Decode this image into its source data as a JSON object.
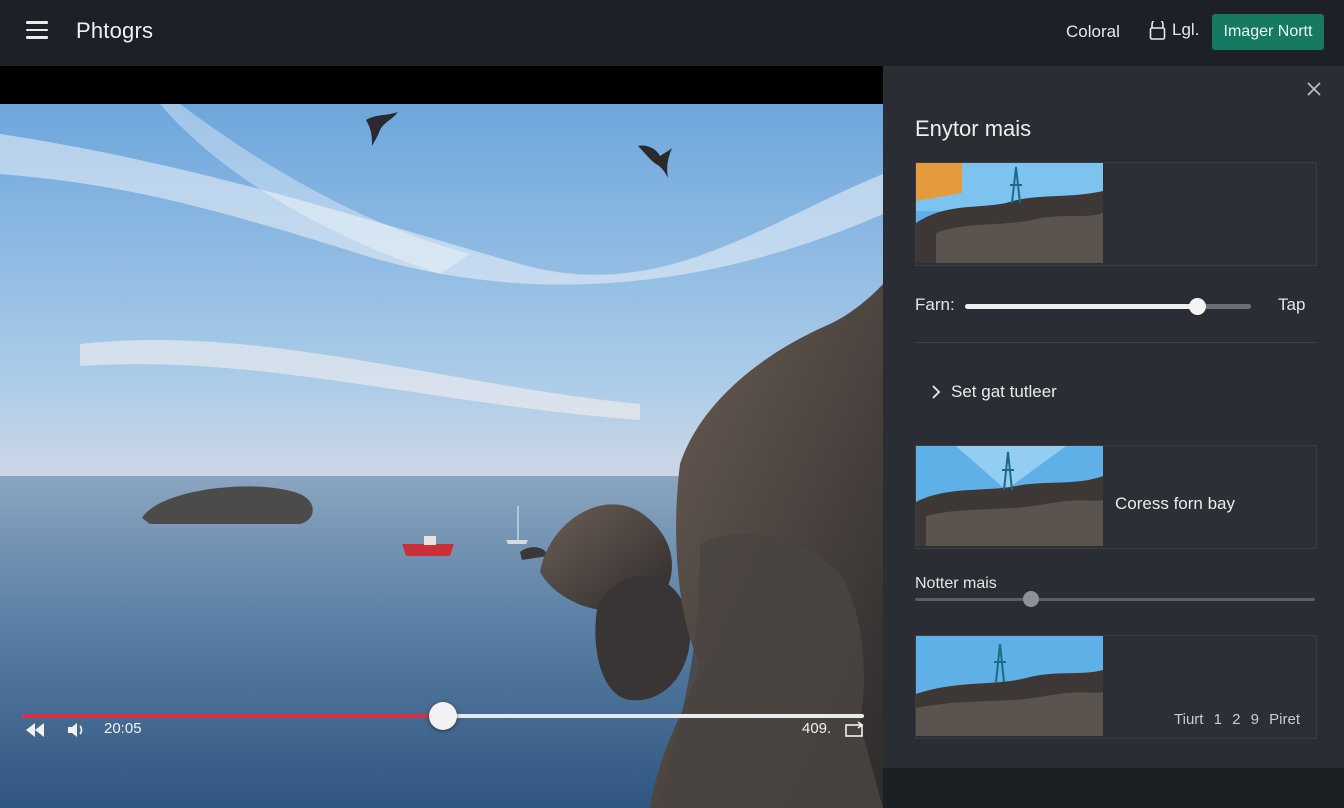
{
  "header": {
    "brand": "Phtogrs",
    "link": "Coloral",
    "login": "Lgl.",
    "cta": "Imager Nortt"
  },
  "player": {
    "current_time": "20:05",
    "duration": "409.",
    "progress": 0.5
  },
  "panel": {
    "title": "Enytor mais",
    "slider": {
      "label": "Farn:",
      "right_label": "Tap",
      "value": 0.81
    },
    "expander_label": "Set gat tutleer",
    "card2_label": "Coress forn bay",
    "thin_slider": {
      "label": "Notter mais",
      "value": 0.29
    },
    "card3_pages": "Tiurt 1 2 9 Piret"
  },
  "colors": {
    "accent": "#167a63",
    "progress": "#d3324a"
  }
}
